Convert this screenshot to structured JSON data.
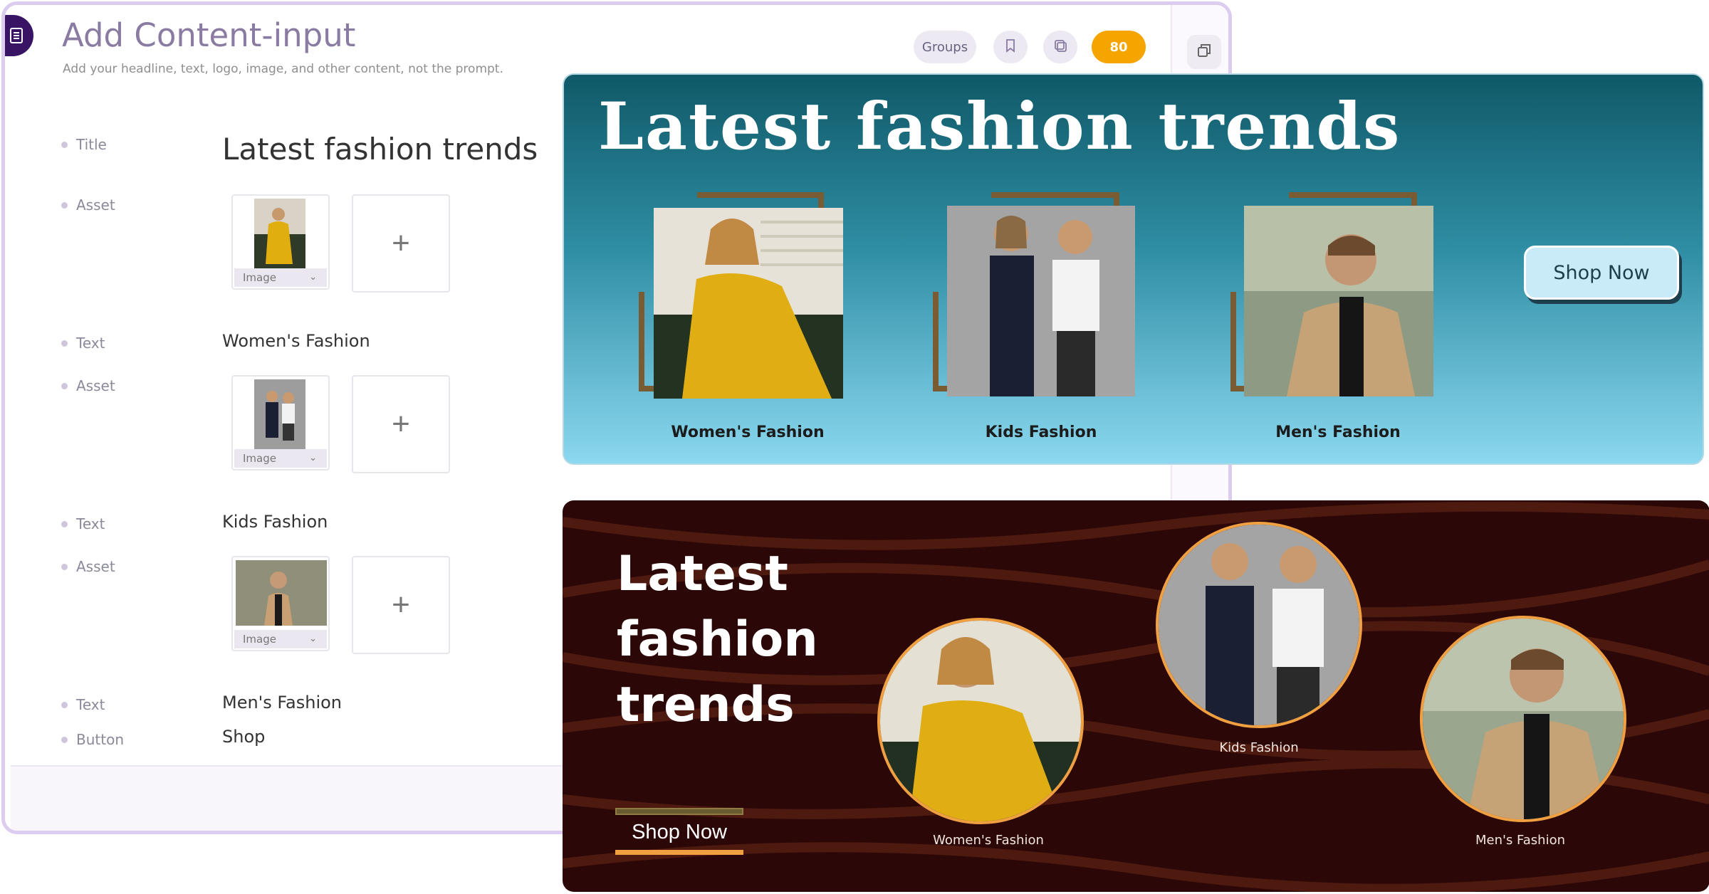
{
  "editor": {
    "title": "Add Content-input",
    "subtitle": "Add your headline, text, logo, image, and other content, not the prompt.",
    "groups_label": "Groups",
    "count": "80"
  },
  "rows": {
    "title_label": "Title",
    "title_value": "Latest fashion trends",
    "asset_label": "Asset",
    "text_label": "Text",
    "button_label": "Button",
    "image_select": "Image",
    "add_symbol": "+",
    "text1": "Women's Fashion",
    "text2": "Kids Fashion",
    "text3": "Men's Fashion",
    "button_value": "Shop"
  },
  "banner1": {
    "title": "Latest fashion trends",
    "labels": [
      "Women's Fashion",
      "Kids Fashion",
      "Men's Fashion"
    ],
    "cta": "Shop Now"
  },
  "banner2": {
    "title": "Latest fashion trends",
    "labels": [
      "Women's Fashion",
      "Kids Fashion",
      "Men's Fashion"
    ],
    "cta": "Shop Now"
  },
  "colors": {
    "accent_purple": "#3a1464",
    "count_badge": "#f6a500",
    "banner1_top": "#0f5968",
    "banner1_bottom": "#8bd8f0",
    "banner2_bg": "#2c0707",
    "banner2_accent": "#f0a040"
  }
}
